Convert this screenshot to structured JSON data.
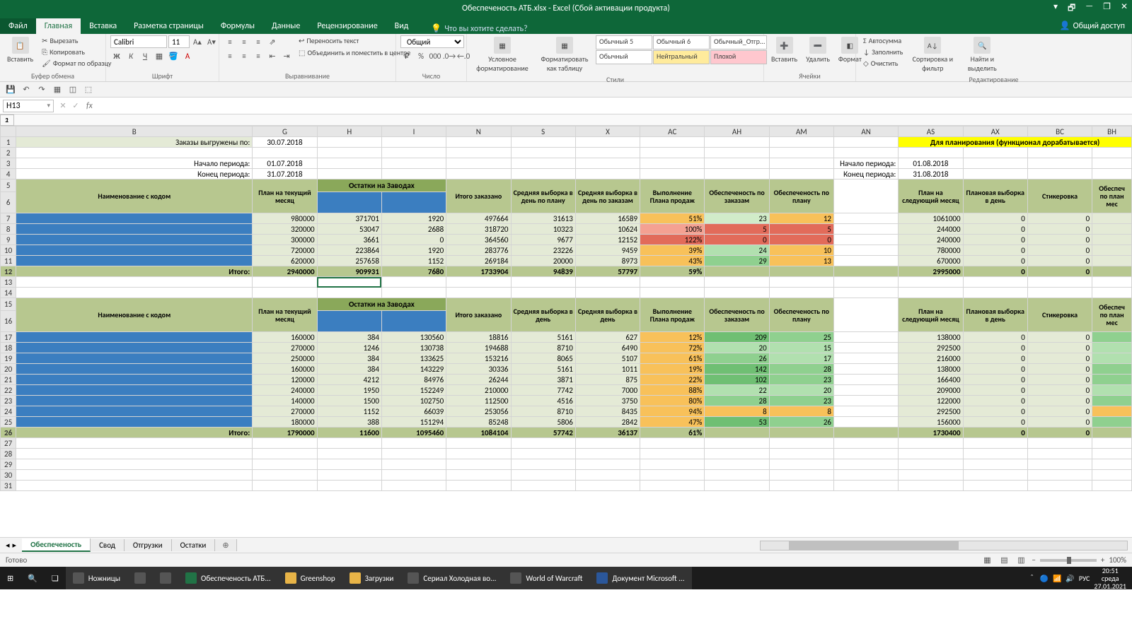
{
  "titlebar": {
    "title": "Обеспеченость АТБ.xlsx - Excel (Сбой активации продукта)"
  },
  "win": {
    "min": "—",
    "max": "❐",
    "close": "✕",
    "restore": "🗗"
  },
  "tabs": {
    "file": "Файл",
    "home": "Главная",
    "insert": "Вставка",
    "layout": "Разметка страницы",
    "formulas": "Формулы",
    "data": "Данные",
    "review": "Рецензирование",
    "view": "Вид",
    "tell": "Что вы хотите сделать?",
    "share": "Общий доступ"
  },
  "ribbon": {
    "clipboard": {
      "label": "Буфер обмена",
      "paste": "Вставить",
      "cut": "Вырезать",
      "copy": "Копировать",
      "format": "Формат по образцу"
    },
    "font": {
      "label": "Шрифт",
      "name": "Calibri",
      "size": "11"
    },
    "align": {
      "label": "Выравнивание",
      "wrap": "Переносить текст",
      "merge": "Объединить и поместить в центре"
    },
    "number": {
      "label": "Число",
      "fmt": "Общий"
    },
    "cond": {
      "label": "Стили",
      "condfmt": "Условное форматирование",
      "astable": "Форматировать как таблицу"
    },
    "styles": {
      "s1": "Обычный 5",
      "s2": "Обычный 6",
      "s3": "Обычный_Отгр...",
      "s4": "Обычный",
      "s5": "Нейтральный",
      "s6": "Плохой"
    },
    "cells": {
      "label": "Ячейки",
      "insert": "Вставить",
      "delete": "Удалить",
      "format": "Формат"
    },
    "edit": {
      "label": "Редактирование",
      "sum": "Автосумма",
      "fill": "Заполнить",
      "clear": "Очистить",
      "sort": "Сортировка и фильтр",
      "find": "Найти и выделить"
    }
  },
  "namebox": "H13",
  "cols": [
    "B",
    "G",
    "H",
    "I",
    "N",
    "S",
    "X",
    "AC",
    "AH",
    "AM",
    "AN",
    "AS",
    "AX",
    "BC",
    "BH"
  ],
  "labels": {
    "orders_loaded": "Заказы выгружены по:",
    "period_start": "Начало периода:",
    "period_end": "Конец периода:",
    "name_with_code": "Наименование с кодом",
    "plan_current": "План на текущий месяц",
    "stock_plants": "Остатки на Заводах",
    "total_ordered": "Итого заказано",
    "avg_plan": "Средняя выборка в день по плану",
    "avg_orders": "Средняя выборка в день по заказам",
    "avg_day": "Средняя выборка в день",
    "plan_exec": "Выполнение Плана продаж",
    "sec_orders": "Обеспеченость по заказам",
    "sec_plan": "Обеспеченость по плану",
    "plan_next": "План на следующий месяц",
    "planned_day": "Плановая выборка в день",
    "sticker": "Стикеровка",
    "sec_plan2": "Обеспеч по план мес",
    "planning_banner": "Для планирования (функционал дорабатывается)",
    "total": "Итого:"
  },
  "dates": {
    "orders": "30.07.2018",
    "p1s": "01.07.2018",
    "p1e": "31.07.2018",
    "p2s": "01.08.2018",
    "p2e": "31.08.2018"
  },
  "block1": {
    "rows": [
      {
        "G": "980000",
        "H": "371701",
        "I": "1920",
        "N": "497664",
        "S": "31613",
        "X": "16589",
        "AC": "51%",
        "AH": "23",
        "AM": "12",
        "AS": "1061000",
        "AX": "0",
        "BC": "0",
        "ac": "amber",
        "ah": "g4",
        "am": "amber"
      },
      {
        "G": "320000",
        "H": "53047",
        "I": "2688",
        "N": "318720",
        "S": "10323",
        "X": "10624",
        "AC": "100%",
        "AH": "5",
        "AM": "5",
        "AS": "244000",
        "AX": "0",
        "BC": "0",
        "ac": "salmon",
        "ah": "red",
        "am": "red"
      },
      {
        "G": "300000",
        "H": "3661",
        "I": "0",
        "N": "364560",
        "S": "9677",
        "X": "12152",
        "AC": "122%",
        "AH": "0",
        "AM": "0",
        "AS": "240000",
        "AX": "0",
        "BC": "0",
        "ac": "red",
        "ah": "red",
        "am": "red"
      },
      {
        "G": "720000",
        "H": "223864",
        "I": "1920",
        "N": "283776",
        "S": "23226",
        "X": "9459",
        "AC": "39%",
        "AH": "24",
        "AM": "10",
        "AS": "780000",
        "AX": "0",
        "BC": "0",
        "ac": "amber",
        "ah": "g3",
        "am": "amber"
      },
      {
        "G": "620000",
        "H": "257658",
        "I": "1152",
        "N": "269184",
        "S": "20000",
        "X": "8973",
        "AC": "43%",
        "AH": "29",
        "AM": "13",
        "AS": "670000",
        "AX": "0",
        "BC": "0",
        "ac": "amber",
        "ah": "g2",
        "am": "amber"
      }
    ],
    "total": {
      "G": "2940000",
      "H": "909931",
      "I": "7680",
      "N": "1733904",
      "S": "94839",
      "X": "57797",
      "AC": "59%",
      "AS": "2995000",
      "AX": "0",
      "BC": "0"
    }
  },
  "block2": {
    "rows": [
      {
        "G": "160000",
        "H": "384",
        "I": "130560",
        "N": "18816",
        "S": "5161",
        "X": "627",
        "AC": "12%",
        "AH": "209",
        "AM": "25",
        "AS": "138000",
        "AX": "0",
        "BC": "0",
        "ac": "amber",
        "ah": "g1",
        "am": "g2"
      },
      {
        "G": "270000",
        "H": "1246",
        "I": "130738",
        "N": "194688",
        "S": "8710",
        "X": "6490",
        "AC": "72%",
        "AH": "20",
        "AM": "15",
        "AS": "292500",
        "AX": "0",
        "BC": "0",
        "ac": "amber",
        "ah": "g3",
        "am": "g3"
      },
      {
        "G": "250000",
        "H": "384",
        "I": "133625",
        "N": "153216",
        "S": "8065",
        "X": "5107",
        "AC": "61%",
        "AH": "26",
        "AM": "17",
        "AS": "216000",
        "AX": "0",
        "BC": "0",
        "ac": "amber",
        "ah": "g2",
        "am": "g3"
      },
      {
        "G": "160000",
        "H": "384",
        "I": "143229",
        "N": "30336",
        "S": "5161",
        "X": "1011",
        "AC": "19%",
        "AH": "142",
        "AM": "28",
        "AS": "138000",
        "AX": "0",
        "BC": "0",
        "ac": "amber",
        "ah": "g1",
        "am": "g2"
      },
      {
        "G": "120000",
        "H": "4212",
        "I": "84976",
        "N": "26244",
        "S": "3871",
        "X": "875",
        "AC": "22%",
        "AH": "102",
        "AM": "23",
        "AS": "166400",
        "AX": "0",
        "BC": "0",
        "ac": "amber",
        "ah": "g1",
        "am": "g2"
      },
      {
        "G": "240000",
        "H": "1950",
        "I": "152249",
        "N": "210000",
        "S": "7742",
        "X": "7000",
        "AC": "88%",
        "AH": "22",
        "AM": "20",
        "AS": "209000",
        "AX": "0",
        "BC": "0",
        "ac": "amber",
        "ah": "g3",
        "am": "g3"
      },
      {
        "G": "140000",
        "H": "1500",
        "I": "102750",
        "N": "112500",
        "S": "4516",
        "X": "3750",
        "AC": "80%",
        "AH": "28",
        "AM": "23",
        "AS": "122000",
        "AX": "0",
        "BC": "0",
        "ac": "amber",
        "ah": "g2",
        "am": "g2"
      },
      {
        "G": "270000",
        "H": "1152",
        "I": "66039",
        "N": "253056",
        "S": "8710",
        "X": "8435",
        "AC": "94%",
        "AH": "8",
        "AM": "8",
        "AS": "292500",
        "AX": "0",
        "BC": "0",
        "ac": "amber",
        "ah": "amber",
        "am": "amber"
      },
      {
        "G": "180000",
        "H": "388",
        "I": "151294",
        "N": "85248",
        "S": "5806",
        "X": "2842",
        "AC": "47%",
        "AH": "53",
        "AM": "26",
        "AS": "156000",
        "AX": "0",
        "BC": "0",
        "ac": "amber",
        "ah": "g1",
        "am": "g2"
      }
    ],
    "total": {
      "G": "1790000",
      "H": "11600",
      "I": "1095460",
      "N": "1084104",
      "S": "57742",
      "X": "36137",
      "AC": "61%",
      "AS": "1730400",
      "AX": "0",
      "BC": "0"
    }
  },
  "sheets": {
    "s1": "Обеспеченость",
    "s2": "Свод",
    "s3": "Отгрузки",
    "s4": "Остатки"
  },
  "status": {
    "ready": "Готово",
    "zoom": "100%"
  },
  "taskbar": {
    "b1": "Ножницы",
    "b2": "Обеспеченость АТБ...",
    "b3": "Greenshop",
    "b4": "Загрузки",
    "b5": "Сериал Холодная во...",
    "b6": "World of Warcraft",
    "b7": "Документ Microsoft ...",
    "lang": "РУС",
    "time": "20:51",
    "day": "среда",
    "date": "27.01.2021"
  }
}
